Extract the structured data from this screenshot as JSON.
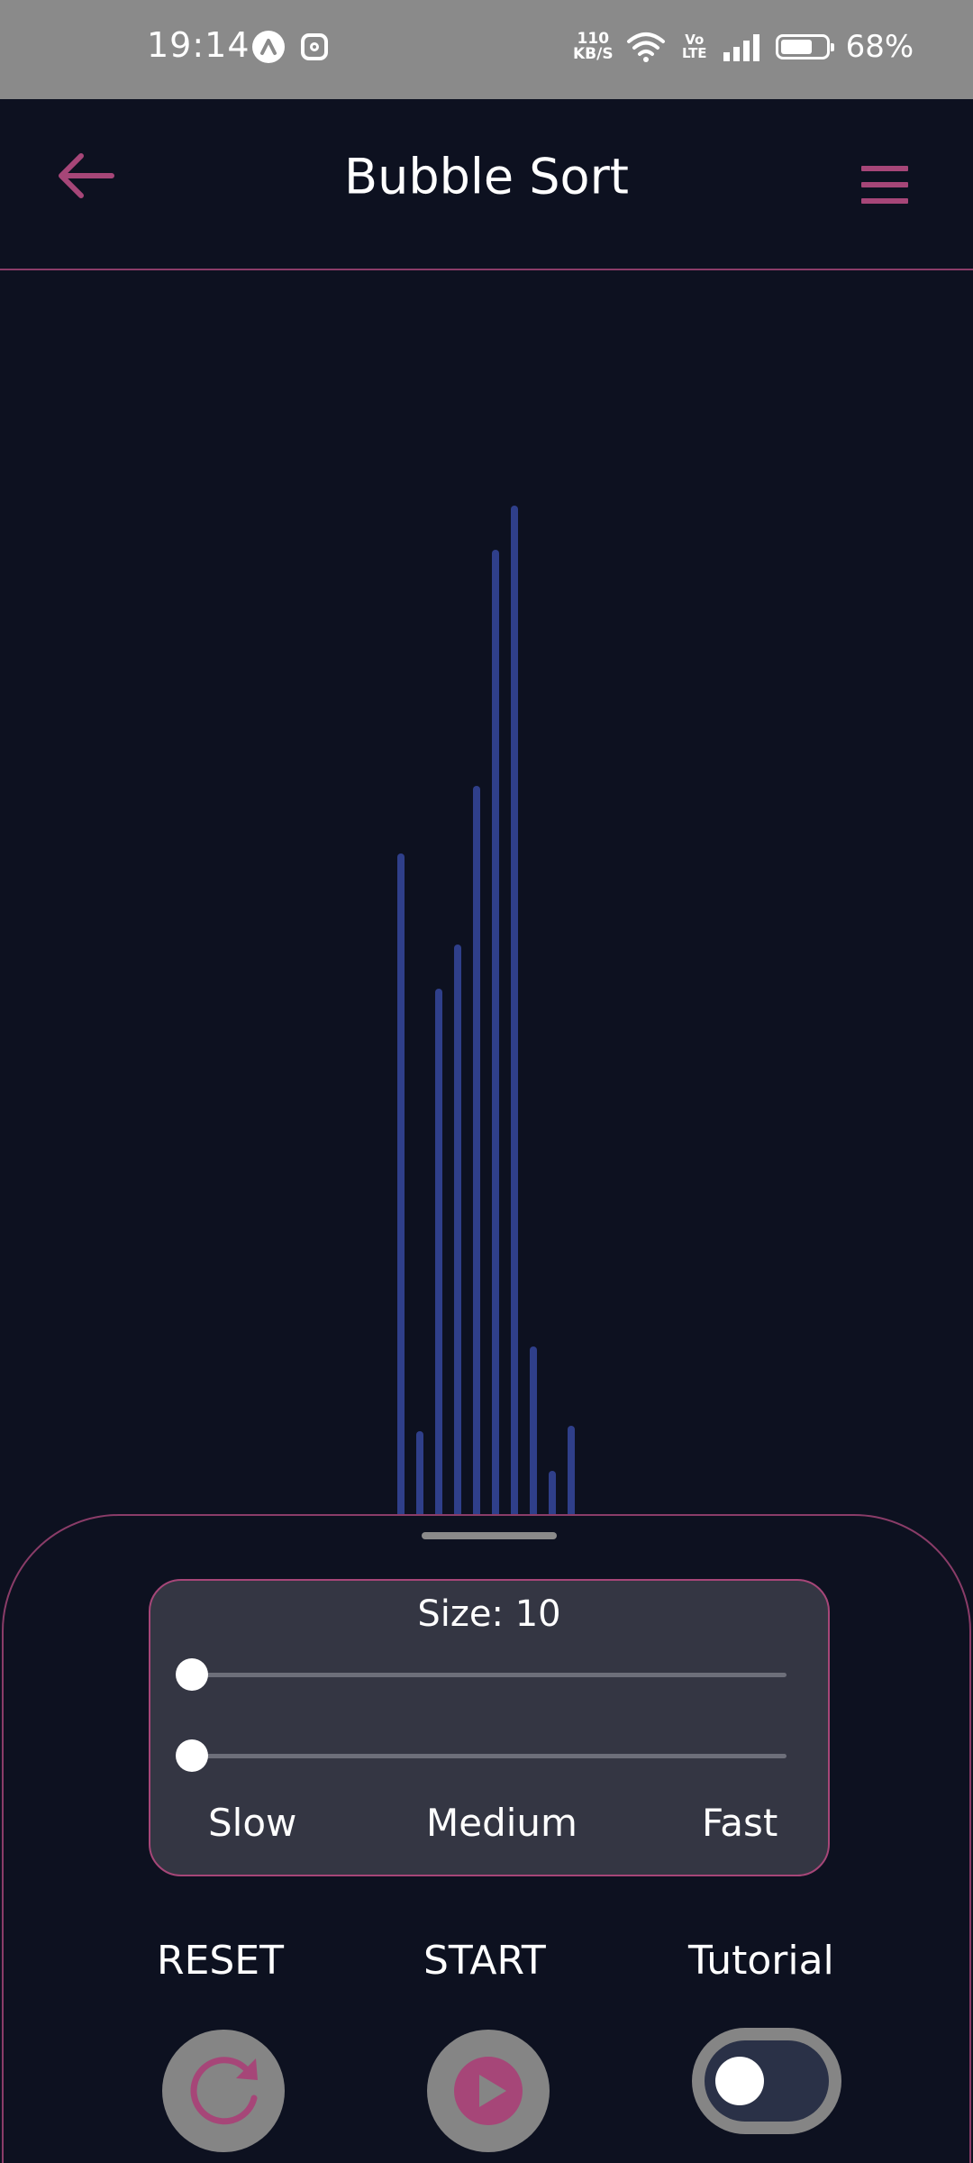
{
  "status_bar": {
    "time": "19:14",
    "net_speed_top": "110",
    "net_speed_bottom": "KB/S",
    "volte_top": "Vo",
    "volte_bottom": "LTE",
    "battery": "68%"
  },
  "header": {
    "title": "Bubble Sort",
    "accent_color": "#a64678"
  },
  "array": {
    "bar_color": "#2f3f8a",
    "values": [
      532,
      68,
      423,
      459,
      586,
      776,
      811,
      136,
      36,
      72
    ]
  },
  "settings": {
    "size_label": "Size: 10",
    "size_value": 10,
    "size_slider_level": 0,
    "speed_slider_level": 0,
    "speed_labels": {
      "slow": "Slow",
      "medium": "Medium",
      "fast": "Fast"
    }
  },
  "actions": {
    "reset_label": "RESET",
    "start_label": "START",
    "tutorial_label": "Tutorial",
    "tutorial_enabled": false
  }
}
